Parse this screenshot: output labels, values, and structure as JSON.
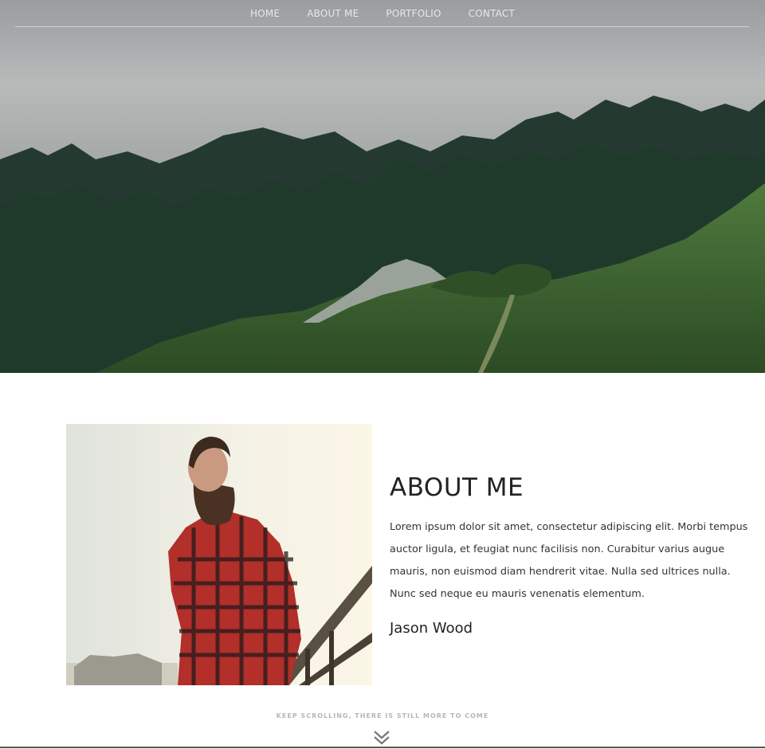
{
  "nav": {
    "items": [
      {
        "label": "HOME"
      },
      {
        "label": "ABOUT ME"
      },
      {
        "label": "PORTFOLIO"
      },
      {
        "label": "CONTACT"
      }
    ]
  },
  "hero": {
    "image": "misty-forest-hillside"
  },
  "about": {
    "title": "ABOUT ME",
    "body": "Lorem ipsum dolor sit amet, consectetur adipiscing elit. Morbi tempus auctor ligula, et feugiat nunc facilisis non. Curabitur varius augue mauris, non euismod diam hendrerit vitae. Nulla sed ultrices nulla. Nunc sed neque eu mauris venenatis elementum.",
    "name": "Jason Wood",
    "portrait": "bearded-man-red-plaid-shirt"
  },
  "footer": {
    "scroll_hint": "KEEP SCROLLING, THERE IS STILL MORE TO COME",
    "chevron_icon": "double-chevron-down-icon"
  }
}
